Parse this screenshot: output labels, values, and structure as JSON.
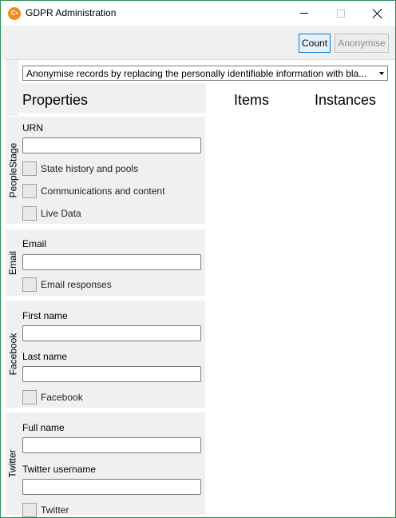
{
  "window": {
    "title": "GDPR Administration",
    "app_icon_text": "C•"
  },
  "toolbar": {
    "count_label": "Count",
    "anonymise_label": "Anonymise"
  },
  "mode_select": {
    "selected": "Anonymise records by replacing the personally identifiable information with bla..."
  },
  "columns": {
    "properties": "Properties",
    "items": "Items",
    "instances": "Instances"
  },
  "groups": {
    "peoplestage": {
      "label": "PeopleStage",
      "urn_label": "URN",
      "urn_value": "",
      "checkboxes": [
        "State history and pools",
        "Communications and content",
        "Live Data"
      ]
    },
    "email": {
      "label": "Email",
      "email_label": "Email",
      "email_value": "",
      "checkboxes": [
        "Email responses"
      ]
    },
    "facebook": {
      "label": "Facebook",
      "first_name_label": "First name",
      "first_name_value": "",
      "last_name_label": "Last name",
      "last_name_value": "",
      "checkboxes": [
        "Facebook"
      ]
    },
    "twitter": {
      "label": "Twitter",
      "full_name_label": "Full name",
      "full_name_value": "",
      "username_label": "Twitter username",
      "username_value": "",
      "checkboxes": [
        "Twitter"
      ]
    }
  },
  "colors": {
    "accent": "#0078d7",
    "window_border": "#2e8b57",
    "panel": "#f0f0f0",
    "app_icon": "#f28c1e"
  }
}
